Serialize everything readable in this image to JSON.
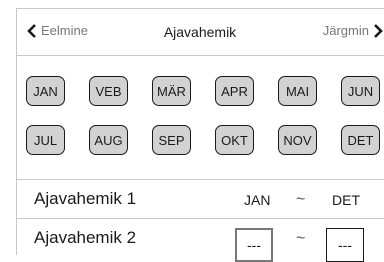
{
  "header": {
    "prev_label": "Eelmine",
    "title": "Ajavahemik",
    "next_label": "Järgmin"
  },
  "months": [
    "JAN",
    "VEB",
    "MÄR",
    "APR",
    "MAI",
    "JUN",
    "JUL",
    "AUG",
    "SEP",
    "OKT",
    "NOV",
    "DET"
  ],
  "rows": [
    {
      "label": "Ajavahemik 1",
      "from": "JAN",
      "separator": "~",
      "to": "DET"
    },
    {
      "label": "Ajavahemik 2",
      "from": "---",
      "separator": "~",
      "to": "---"
    }
  ],
  "icons": {
    "prev": "chevron-left-icon",
    "next": "chevron-right-icon"
  },
  "colors": {
    "month_fill": "#d2d2d2",
    "border": "#1a1a1a",
    "divider": "#c8c8c8",
    "nav_text": "#777777"
  }
}
